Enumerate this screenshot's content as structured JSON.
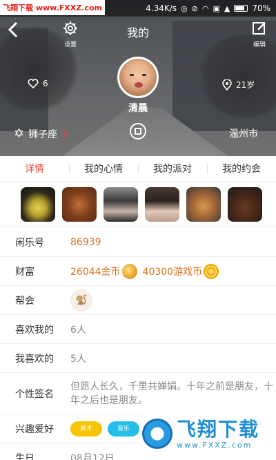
{
  "watermark": {
    "top_text": "飞翔下载 www.FXXZ.com",
    "logo_text": "飞翔下载",
    "logo_url": "www.FXXZ.com"
  },
  "status_bar": {
    "speed": "4.34K/s",
    "battery": "70%",
    "battery_level": 0.7
  },
  "nav": {
    "title": "我的",
    "settings_label": "设置",
    "edit_label": "编辑"
  },
  "profile": {
    "nickname": "清晨",
    "likes": "6",
    "age": "21岁",
    "zodiac": "狮子座",
    "city": "温州市"
  },
  "tabs": [
    {
      "label": "详情",
      "active": true
    },
    {
      "label": "我的心情",
      "active": false
    },
    {
      "label": "我的派对",
      "active": false
    },
    {
      "label": "我的约会",
      "active": false
    }
  ],
  "info": {
    "id_key": "闲乐号",
    "id_value": "86939",
    "wealth_key": "财富",
    "gold_value": "26044金币",
    "game_coin_value": "40300游戏币",
    "gang_key": "帮会",
    "gang_badge": "帮会",
    "liked_me_key": "喜欢我的",
    "liked_me_value": "6人",
    "i_like_key": "我喜欢的",
    "i_like_value": "5人",
    "signature_key": "个性签名",
    "signature_value": "但愿人长久，千里共婵娟。十年之前是朋友，十年之后也是朋友。",
    "hobby_key": "兴趣爱好",
    "hobbies": [
      "美术",
      "音乐"
    ],
    "birthday_key": "生日",
    "birthday_value": "08月12日"
  },
  "colors": {
    "accent": "#e84a3c",
    "orange": "#d9731b",
    "tag_yellow": "#f6c400",
    "tag_cyan": "#26bde6"
  }
}
